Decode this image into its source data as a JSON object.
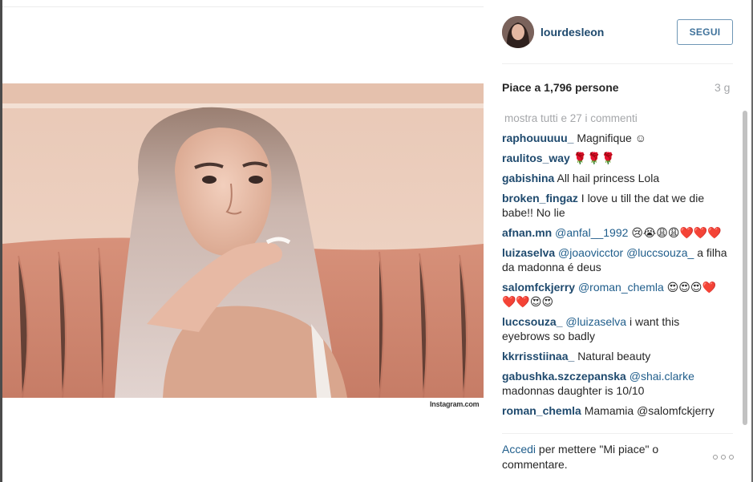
{
  "post": {
    "photo_credit": "Instagram.com"
  },
  "header": {
    "username": "lourdesleon",
    "follow_label": "SEGUI"
  },
  "stats": {
    "likes_text": "Piace a 1,796 persone",
    "time_ago": "3 g"
  },
  "comments": {
    "show_all": "mostra tutti e 27 i commenti",
    "items": [
      {
        "user": "raphouuuuu_",
        "mention": "",
        "text": "Magnifique ☺"
      },
      {
        "user": "raulitos_way",
        "mention": "",
        "text": "🌹🌹🌹"
      },
      {
        "user": "gabishina",
        "mention": "",
        "text": "All hail princess Lola"
      },
      {
        "user": "broken_fingaz",
        "mention": "",
        "text": "I love u till the dat we die babe!! No lie"
      },
      {
        "user": "afnan.mn",
        "mention": "@anfal__1992",
        "text": "😢😭😩😩❤️❤️❤️"
      },
      {
        "user": "luizaselva",
        "mention": "@joaovicctor @luccsouza_",
        "text": "a filha da madonna é deus"
      },
      {
        "user": "salomfckjerry",
        "mention": "@roman_chemla",
        "text": "😍😍😍❤️❤️❤️😍😍"
      },
      {
        "user": "luccsouza_",
        "mention": "@luizaselva",
        "text": "i want this eyebrows so badly"
      },
      {
        "user": "kkrrisstiinaa_",
        "mention": "",
        "text": "Natural beauty"
      },
      {
        "user": "gabushka.szczepanska",
        "mention": "@shai.clarke",
        "text": "madonnas daughter is 10/10"
      },
      {
        "user": "roman_chemla",
        "mention": "",
        "text": "Mamamia @salomfckjerry"
      }
    ]
  },
  "footer": {
    "login_link": "Accedi",
    "login_rest": "per mettere \"Mi piace\" o commentare.",
    "more_icon": "ellipsis-icon"
  },
  "colors": {
    "link_blue": "#1f4a6e",
    "follow_blue": "#3f729b",
    "muted_gray": "#a5a7aa"
  }
}
